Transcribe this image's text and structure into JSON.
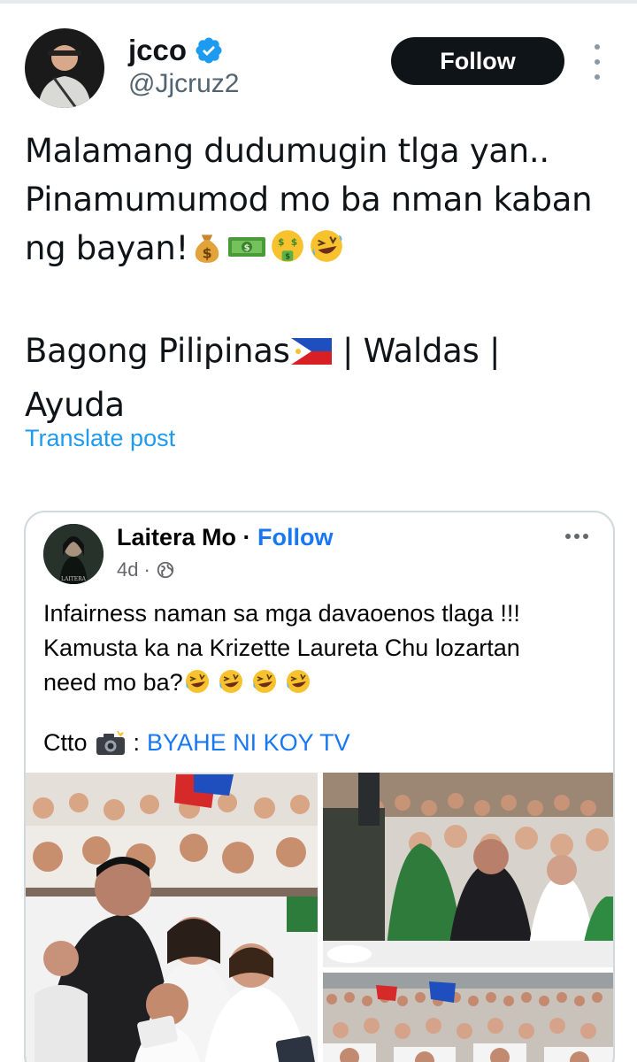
{
  "tweet": {
    "author": {
      "name": "jcco",
      "handle": "@Jjcruz2",
      "avatar_icon": "person-avatar",
      "verified": true
    },
    "follow_label": "Follow",
    "text_lines": [
      "Malamang dudumugin tlga yan..",
      "Pinamumumod mo ba nman kaban",
      "ng bayan!"
    ],
    "tags_line1": "Bagong Pilipinas",
    "tags_line1_rest": " | Waldas |",
    "tags_line2": "Ayuda",
    "emojis": [
      "money-bag",
      "dollar-banknote",
      "money-mouth-face",
      "rolling-laughing-face",
      "philippines-flag"
    ],
    "translate_label": "Translate post"
  },
  "embedded_post": {
    "author": "Laitera Mo",
    "separator": " · ",
    "follow_label": "Follow",
    "age": "4d",
    "dot": "·",
    "text_line1": "Infairness naman sa mga davaoenos tlaga !!!",
    "text_line2": "Kamusta ka na Krizette Laureta Chu lozartan",
    "text_line3": "need mo ba?",
    "ctto_label": "Ctto",
    "ctto_sep": ":",
    "ctto_link": "BYAHE NI KOY TV",
    "avatar_caption": "LAITERA"
  },
  "colors": {
    "accent": "#1d9bf0",
    "fb_blue": "#1877f2",
    "text": "#0f1419",
    "muted": "#536471"
  }
}
